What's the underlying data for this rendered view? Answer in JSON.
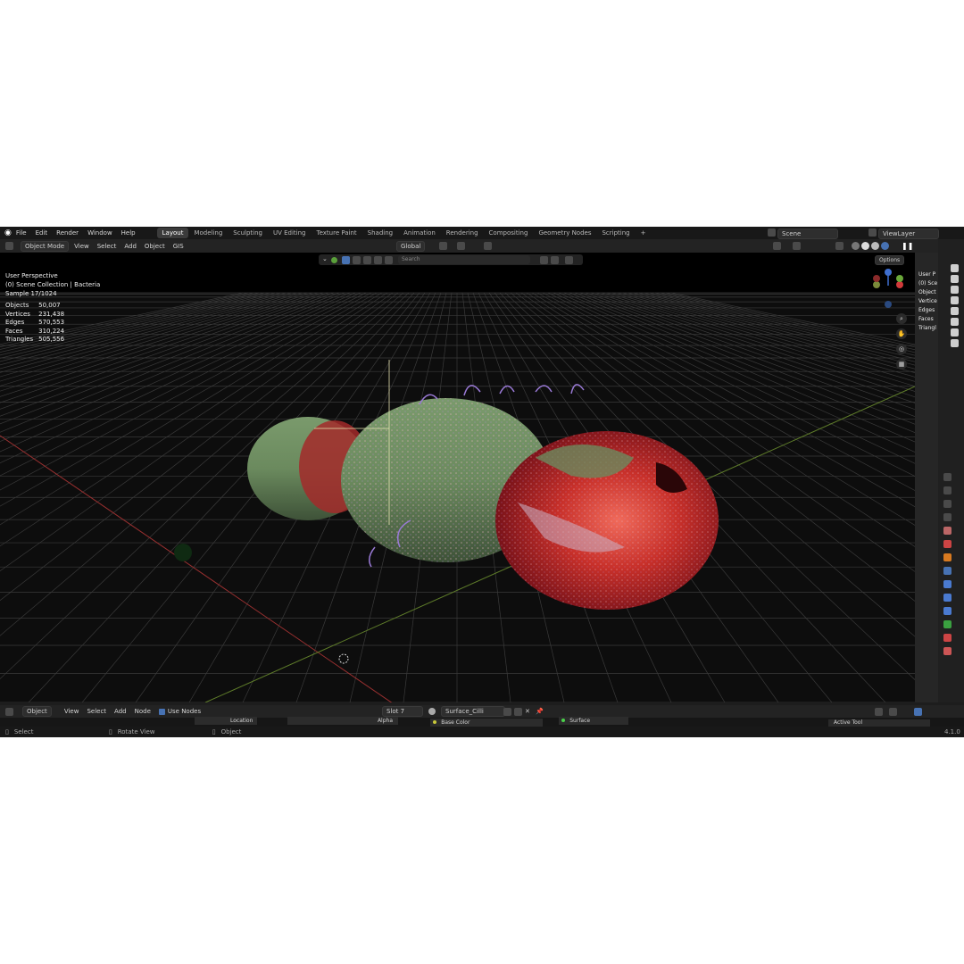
{
  "topbar": {
    "menus": [
      "File",
      "Edit",
      "Render",
      "Window",
      "Help"
    ],
    "workspaces": [
      "Layout",
      "Modeling",
      "Sculpting",
      "UV Editing",
      "Texture Paint",
      "Shading",
      "Animation",
      "Rendering",
      "Compositing",
      "Geometry Nodes",
      "Scripting"
    ],
    "active_workspace": "Layout",
    "add_tab": "+",
    "scene": "Scene",
    "view_layer": "ViewLayer"
  },
  "header": {
    "mode": "Object Mode",
    "menus": [
      "View",
      "Select",
      "Add",
      "Object",
      "GIS"
    ],
    "transform_orientation": "Global",
    "search_placeholder": "Search",
    "options": "Options"
  },
  "viewport": {
    "perspective": "User Perspective",
    "collection": "(0) Scene Collection | Bacteria",
    "sample": "Sample 17/1024",
    "stats": [
      {
        "label": "Objects",
        "value": "50,007"
      },
      {
        "label": "Vertices",
        "value": "231,438"
      },
      {
        "label": "Edges",
        "value": "570,553"
      },
      {
        "label": "Faces",
        "value": "310,224"
      },
      {
        "label": "Triangles",
        "value": "505,556"
      }
    ],
    "right_overlay": [
      "User P",
      "(0) Sce",
      "Object",
      "Vertice",
      "Edges",
      "Faces",
      "Triangl"
    ],
    "gizmo_axes": {
      "x": "X",
      "y": "Y",
      "z": "Z"
    }
  },
  "node_editor": {
    "editor_type": "Object",
    "menus": [
      "View",
      "Select",
      "Add",
      "Node"
    ],
    "use_nodes": "Use Nodes",
    "slot": "Slot 7",
    "material": "Surface_Cilli",
    "sockets": [
      "Location",
      "Alpha",
      "Base Color",
      "Surface"
    ],
    "panel": "Active Tool"
  },
  "statusbar": {
    "items": [
      "Select",
      "Rotate View",
      "Object"
    ],
    "version": "4.1.0"
  },
  "colors": {
    "accent": "#4772b3",
    "x_axis": "#d03a3a",
    "y_axis": "#6aa83a",
    "z_axis": "#3f6fd0",
    "background": "#0d0d0d"
  }
}
